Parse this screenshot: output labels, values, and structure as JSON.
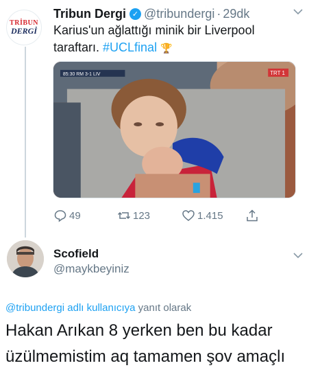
{
  "tweet": {
    "author_name": "Tribun Dergi",
    "author_handle": "@tribundergi",
    "separator": "·",
    "time": "29dk",
    "avatar_text_top": "TRİBUN",
    "avatar_text_bottom": "DERGİ",
    "text_plain": "Karius'un ağlattığı minik bir Liverpool taraftarı. ",
    "hashtag": "#UCLfinal",
    "hashtag_emoji": "🏆",
    "media_scoreboard": "85:30 RM 3-1 LIV",
    "media_channel": "TRT 1",
    "replies": "49",
    "retweets": "123",
    "likes": "1.415"
  },
  "reply": {
    "author_name": "Scofield",
    "author_handle": "@maykbeyiniz",
    "replying_to_link": "@tribundergi adlı kullanıcıya",
    "replying_to_suffix": " yanıt olarak",
    "text": "Hakan Arıkan 8 yerken ben bu kadar üzülmemistim aq tamamen şov amaçlı"
  },
  "colors": {
    "accent": "#1da1f2",
    "muted": "#657786",
    "text": "#14171a"
  }
}
